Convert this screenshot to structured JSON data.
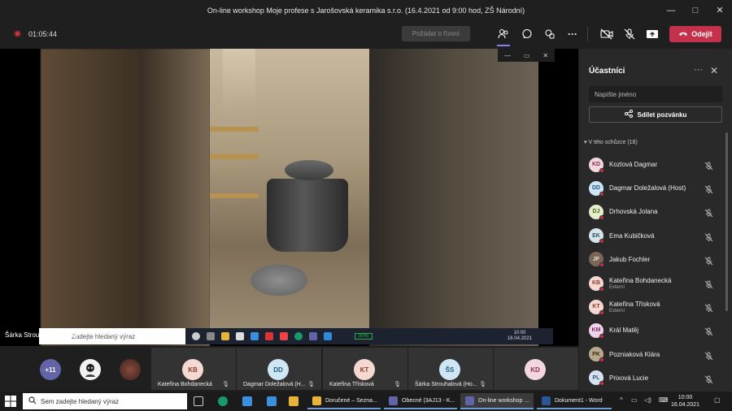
{
  "window": {
    "title": "On-line workshop Moje profese s Jarošovská keramika s.r.o. (16.4.2021 od 9:00 hod, ZŠ Národní)",
    "controls": [
      "—",
      "□",
      "✕"
    ]
  },
  "toolbar": {
    "timer": "01:05:44",
    "request_control": "Požádat o řízení",
    "leave": "Odejít",
    "colors": {
      "leave_bg": "#c4314b",
      "record": "#e02f3c"
    }
  },
  "stage": {
    "presenter_label": "Šárka Strouhalová (Host)",
    "shared_search_placeholder": "Zadejte hledaný výraz",
    "shared_battery": "80%",
    "shared_time": "10:00",
    "shared_date": "16.04.2021"
  },
  "panel": {
    "title": "Účastníci",
    "search_placeholder": "Napište jméno",
    "share_invite": "Sdílet pozvánku",
    "section": "V této schůzce (18)",
    "participants": [
      {
        "initials": "KD",
        "name": "Kozlová Dagmar",
        "sub": "",
        "bg": "#f3d7e0",
        "fg": "#8b2e4a",
        "status": "#c4314b"
      },
      {
        "initials": "DD",
        "name": "Dagmar Doležalová (Host)",
        "sub": "",
        "bg": "#cfe6f5",
        "fg": "#1e5a80",
        "status": "#c4314b"
      },
      {
        "initials": "DJ",
        "name": "Drhovská Jolana",
        "sub": "",
        "bg": "#e4ecc9",
        "fg": "#4d6414",
        "status": "#c4314b"
      },
      {
        "initials": "EK",
        "name": "Ema Kubičková",
        "sub": "",
        "bg": "#d5e4ea",
        "fg": "#305364",
        "status": "#c4314b"
      },
      {
        "initials": "JF",
        "name": "Jakub Fochler",
        "sub": "",
        "bg": "#7a6656",
        "fg": "#e9dfd2",
        "status": "#c4314b"
      },
      {
        "initials": "KB",
        "name": "Kateřina Bohdanecká",
        "sub": "Externí",
        "bg": "#f6d8d3",
        "fg": "#8a3a2b",
        "status": "#c4314b"
      },
      {
        "initials": "KT",
        "name": "Kateřina Třísková",
        "sub": "Externí",
        "bg": "#f6d8d3",
        "fg": "#8a3a2b",
        "status": "#c4314b"
      },
      {
        "initials": "KM",
        "name": "Král Matěj",
        "sub": "",
        "bg": "#f0d3ea",
        "fg": "#7d2f6d",
        "status": "#c4314b"
      },
      {
        "initials": "PK",
        "name": "Pozniaková Klára",
        "sub": "",
        "bg": "#b8a98e",
        "fg": "#3b3121",
        "status": "#c4314b"
      },
      {
        "initials": "PL",
        "name": "Prixová Lucie",
        "sub": "",
        "bg": "#d7e2f0",
        "fg": "#35507a",
        "status": "#c4314b"
      }
    ]
  },
  "gallery": {
    "overflow": "+11",
    "tiles": [
      {
        "initials": "KB",
        "label": "Kateřina Bohdanecká",
        "bg": "#f6d8d3",
        "fg": "#8a3a2b"
      },
      {
        "initials": "DD",
        "label": "Dagmar Doležalová (H...",
        "bg": "#cfe6f5",
        "fg": "#1e5a80"
      },
      {
        "initials": "KT",
        "label": "Kateřina Třísková",
        "bg": "#f6d8d3",
        "fg": "#8a3a2b"
      },
      {
        "initials": "ŠS",
        "label": "Šárka Strouhalová (Ho...",
        "bg": "#cfe6f5",
        "fg": "#1e5a80"
      },
      {
        "initials": "KD",
        "label": "",
        "bg": "#f3d7e0",
        "fg": "#8b2e4a"
      }
    ]
  },
  "taskbar": {
    "search_placeholder": "Sem zadejte hledaný výraz",
    "apps": [
      {
        "label": "Doručené – Sezna...",
        "icon": "chrome-icon",
        "color": "#e7b33a"
      },
      {
        "label": "Obecné (3AJ13 - K...",
        "icon": "teams-icon",
        "color": "#6264a7"
      },
      {
        "label": "On-line workshop ...",
        "icon": "teams-icon",
        "color": "#6264a7"
      },
      {
        "label": "Dokument1 - Word",
        "icon": "word-icon",
        "color": "#2b5797"
      }
    ],
    "time": "10:00",
    "date": "16.04.2021"
  }
}
